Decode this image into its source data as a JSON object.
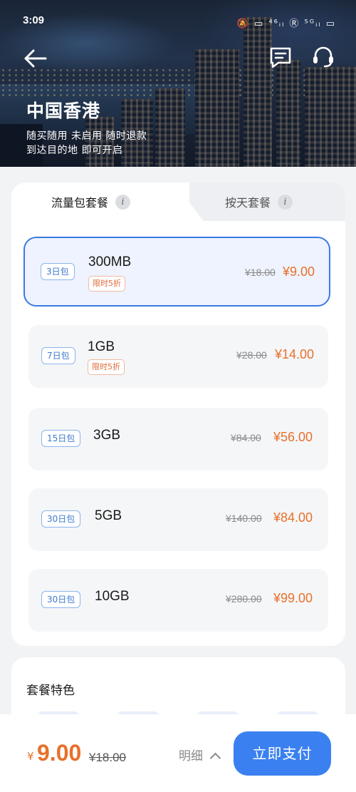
{
  "status_bar": {
    "time": "3:09",
    "icons_text": "🔕 ▭ ⁴⁶ᵢₗ Ⓡ ⁵ᴳᵢₗ ▭"
  },
  "header": {
    "title": "中国香港",
    "subtitle_line1": "随买随用 未启用 随时退款",
    "subtitle_line2": "到达目的地 即可开启",
    "icons": [
      "arrow-left-icon",
      "message-icon",
      "headset-icon"
    ]
  },
  "tabs": [
    {
      "label": "流量包套餐",
      "active": true
    },
    {
      "label": "按天套餐",
      "active": false
    }
  ],
  "packages": [
    {
      "days": "3日包",
      "size": "300MB",
      "tag": "限时5折",
      "old_price": "¥18.00",
      "new_price": "¥9.00",
      "selected": true
    },
    {
      "days": "7日包",
      "size": "1GB",
      "tag": "限时5折",
      "old_price": "¥28.00",
      "new_price": "¥14.00",
      "selected": false
    },
    {
      "days": "15日包",
      "size": "3GB",
      "old_price": "¥84.00",
      "new_price": "¥56.00",
      "selected": false
    },
    {
      "days": "30日包",
      "size": "5GB",
      "old_price": "¥140.00",
      "new_price": "¥84.00",
      "selected": false
    },
    {
      "days": "30日包",
      "size": "10GB",
      "old_price": "¥280.00",
      "new_price": "¥99.00",
      "selected": false
    }
  ],
  "features": {
    "title": "套餐特色"
  },
  "footer": {
    "currency": "¥",
    "total": "9.00",
    "old_total": "¥18.00",
    "detail_label": "明细",
    "pay_label": "立即支付"
  },
  "colors": {
    "accent": "#3a80f0",
    "price": "#e8702a",
    "selected_border": "#3a7be0"
  }
}
